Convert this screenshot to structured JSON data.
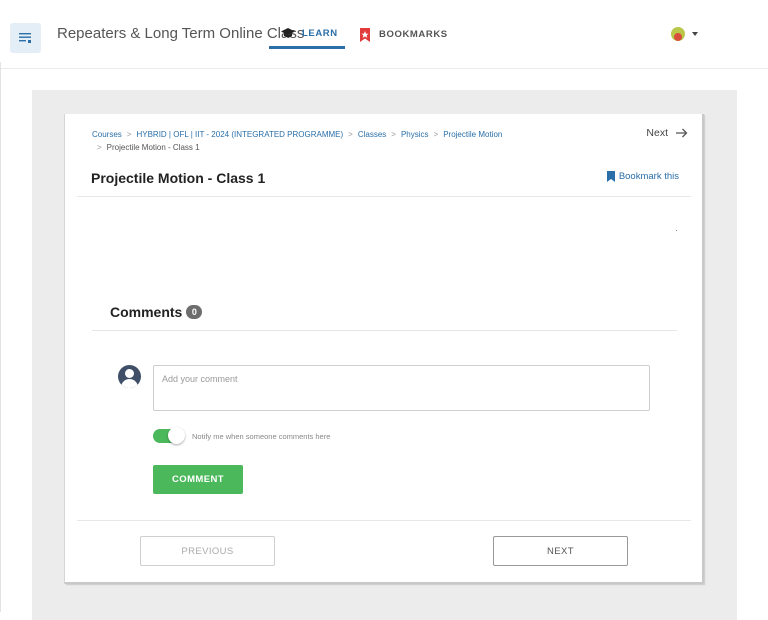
{
  "header": {
    "app_title": "Repeaters & Long Term Online Class",
    "tabs": [
      {
        "label": "LEARN",
        "icon": "graduation-cap-icon",
        "active": true
      },
      {
        "label": "BOOKMARKS",
        "icon": "bookmark-star-icon",
        "active": false
      }
    ]
  },
  "breadcrumb": {
    "items": [
      "Courses",
      "HYBRID | OFL | IIT - 2024 (INTEGRATED PROGRAMME)",
      "Classes",
      "Physics",
      "Projectile Motion"
    ],
    "current": "Projectile Motion - Class 1",
    "separator": ">"
  },
  "next_top_label": "Next",
  "page_title": "Projectile Motion - Class 1",
  "bookmark_label": "Bookmark this",
  "comments": {
    "heading": "Comments",
    "count": "0",
    "placeholder": "Add your comment",
    "notify_label": "Notify me when someone comments here",
    "notify_enabled": true,
    "submit_label": "COMMENT"
  },
  "pager": {
    "previous_label": "PREVIOUS",
    "next_label": "NEXT"
  },
  "colors": {
    "accent": "#2a6fa8",
    "success": "#4cb85c",
    "panel_bg": "#ececec"
  }
}
